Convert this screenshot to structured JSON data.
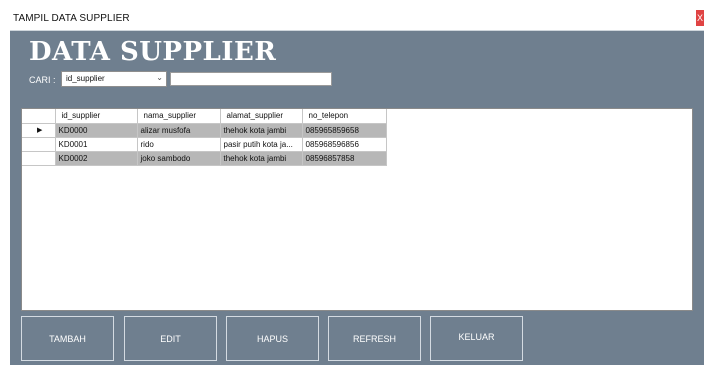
{
  "window": {
    "title": "TAMPIL DATA SUPPLIER",
    "close_label": "X"
  },
  "heading": "DATA SUPPLIER",
  "search": {
    "label": "CARI :",
    "field_selected": "id_supplier",
    "query": ""
  },
  "table": {
    "columns": [
      "id_supplier",
      "nama_supplier",
      "alamat_supplier",
      "no_telepon"
    ],
    "rows": [
      [
        "KD0000",
        "alizar musfofa",
        "thehok kota jambi",
        "085965859658"
      ],
      [
        "KD0001",
        "rido",
        "pasir putih kota ja...",
        "085968596856"
      ],
      [
        "KD0002",
        "joko sambodo",
        "thehok kota jambi",
        "08596857858"
      ]
    ],
    "current_row_marker": "▶"
  },
  "buttons": {
    "tambah": "TAMBAH",
    "edit": "EDIT",
    "hapus": "HAPUS",
    "refresh": "REFRESH",
    "keluar": "KELUAR"
  },
  "colors": {
    "window_bg": "#6f7f8f",
    "row_alt": "#b7b7b7",
    "close_red": "#e04343"
  }
}
